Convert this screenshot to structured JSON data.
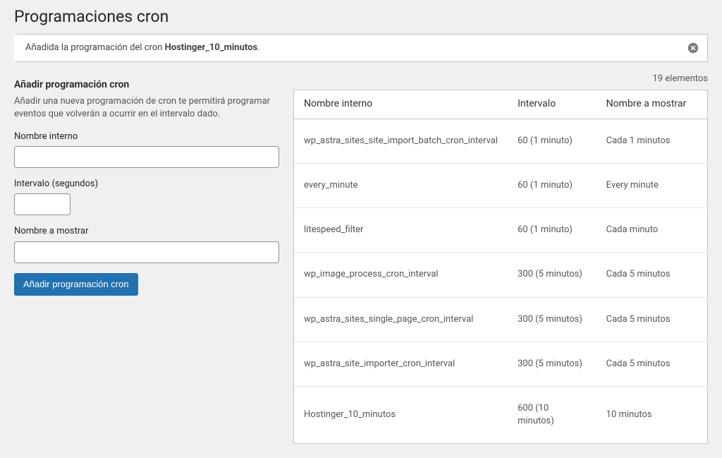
{
  "page_title": "Programaciones cron",
  "notice": {
    "prefix": "Añadida la programación del cron ",
    "name": "Hostinger_10_minutos",
    "suffix": "."
  },
  "count_label": "19 elementos",
  "form": {
    "heading": "Añadir programación cron",
    "description": "Añadir una nueva programación de cron te permitirá programar eventos que volverán a ocurrir en el intervalo dado.",
    "internal_label": "Nombre interno",
    "interval_label": "Intervalo (segundos)",
    "display_label": "Nombre a mostrar",
    "submit_label": "Añadir programación cron",
    "internal_value": "",
    "interval_value": "",
    "display_value": ""
  },
  "table": {
    "headers": {
      "name": "Nombre interno",
      "interval": "Intervalo",
      "display": "Nombre a mostrar"
    },
    "rows": [
      {
        "name": "wp_astra_sites_site_import_batch_cron_interval",
        "interval": "60 (1 minuto)",
        "display": "Cada 1 minutos"
      },
      {
        "name": "every_minute",
        "interval": "60 (1 minuto)",
        "display": "Every minute"
      },
      {
        "name": "litespeed_filter",
        "interval": "60 (1 minuto)",
        "display": "Cada minuto"
      },
      {
        "name": "wp_image_process_cron_interval",
        "interval": "300 (5 minutos)",
        "display": "Cada 5 minutos"
      },
      {
        "name": "wp_astra_sites_single_page_cron_interval",
        "interval": "300 (5 minutos)",
        "display": "Cada 5 minutos"
      },
      {
        "name": "wp_astra_site_importer_cron_interval",
        "interval": "300 (5 minutos)",
        "display": "Cada 5 minutos"
      },
      {
        "name": "Hostinger_10_minutos",
        "interval": "600 (10 minutos)",
        "display": "10 minutos"
      }
    ]
  }
}
